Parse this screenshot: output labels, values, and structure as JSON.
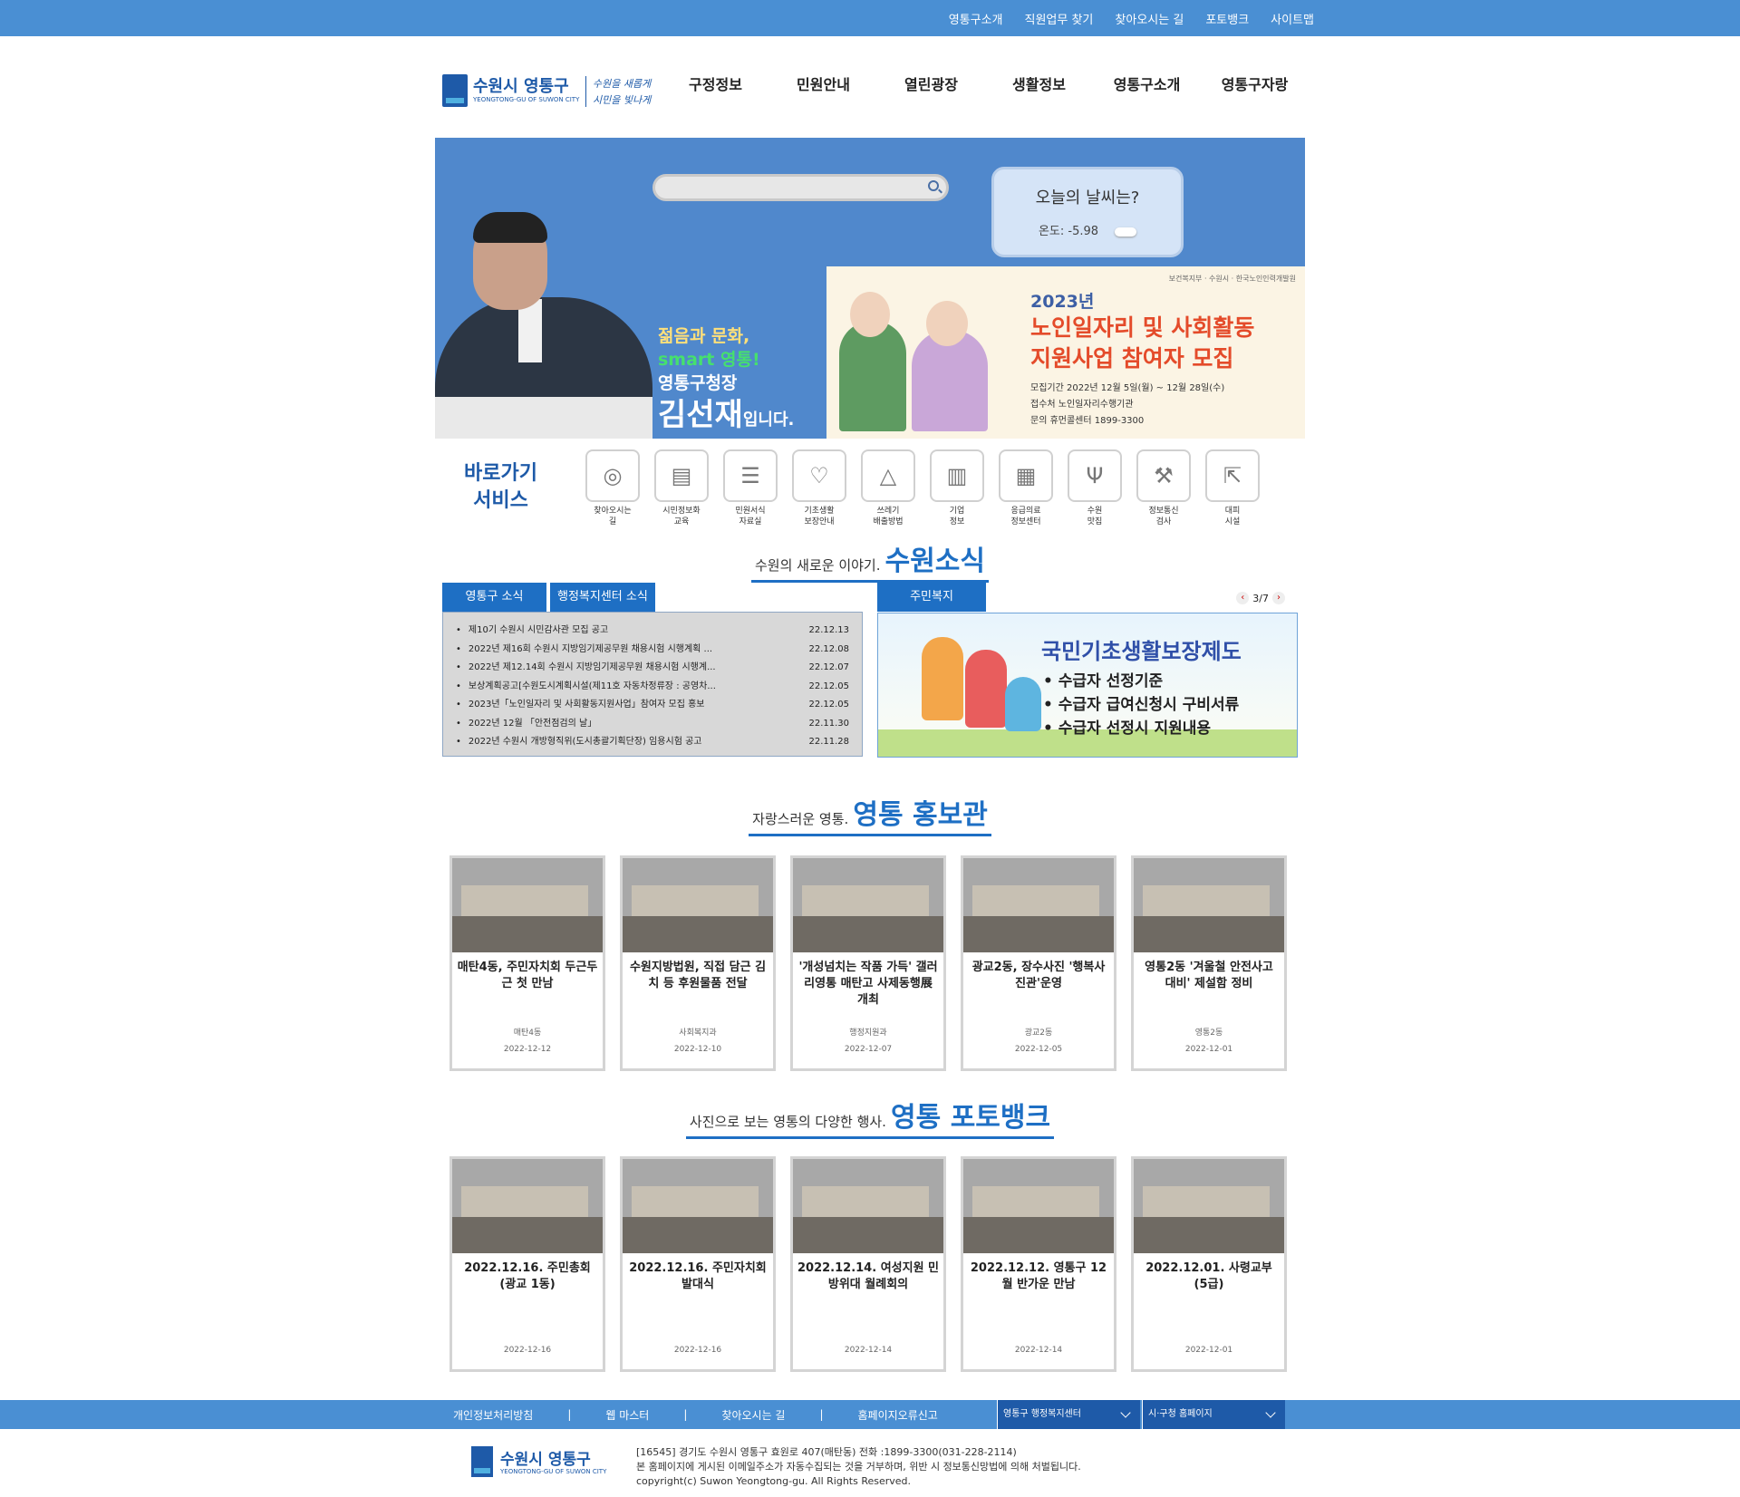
{
  "top_links": [
    "영통구소개",
    "직원업무 찾기",
    "찾아오시는 길",
    "포토뱅크",
    "사이트맵"
  ],
  "logo": {
    "name": "수원시 영통구",
    "eng": "YEONGTONG-GU OF SUWON CITY",
    "slogan1": "수원을 새롭게",
    "slogan2": "시민을 빛나게"
  },
  "nav": [
    "구정정보",
    "민원안내",
    "열린광장",
    "생활정보",
    "영통구소개",
    "영통구자랑"
  ],
  "weather": {
    "title": "오늘의 날씨는?",
    "temp": "온도: -5.98"
  },
  "hero": {
    "line1": "젊음과 문화,",
    "line2": "smart 영통!",
    "line3": "영통구청장",
    "name": "김선재",
    "suffix": "입니다."
  },
  "banner": {
    "logos": "보건복지부 · 수원시 · 한국노인인력개발원",
    "year": "2023년",
    "title1": "노인일자리 및 사회활동",
    "title2": "지원사업 참여자 모집",
    "info1": "모집기간  2022년 12월 5일(월) ~ 12월 28일(수)",
    "info2": "접수처  노인일자리수행기관",
    "info3": "문의  휴먼콜센터 1899-3300"
  },
  "quick": {
    "title1": "바로가기",
    "title2": "서비스",
    "items": [
      {
        "icon": "compass-icon",
        "glyph": "◎",
        "l1": "찾아오시는",
        "l2": "길"
      },
      {
        "icon": "book-icon",
        "glyph": "▤",
        "l1": "시민정보화",
        "l2": "교육"
      },
      {
        "icon": "clipboard-icon",
        "glyph": "☰",
        "l1": "민원서식",
        "l2": "자료실"
      },
      {
        "icon": "heart-icon",
        "glyph": "♡",
        "l1": "기초생활",
        "l2": "보장안내"
      },
      {
        "icon": "trash-bag-icon",
        "glyph": "△",
        "l1": "쓰레기",
        "l2": "배출방법"
      },
      {
        "icon": "building-icon",
        "glyph": "▥",
        "l1": "기업",
        "l2": "정보"
      },
      {
        "icon": "hospital-icon",
        "glyph": "▦",
        "l1": "응급의료",
        "l2": "정보센터"
      },
      {
        "icon": "fork-knife-icon",
        "glyph": "Ψ",
        "l1": "수원",
        "l2": "맛집"
      },
      {
        "icon": "hammer-icon",
        "glyph": "⚒",
        "l1": "정보통신",
        "l2": "검사"
      },
      {
        "icon": "running-exit-icon",
        "glyph": "⇱",
        "l1": "대피",
        "l2": "시설"
      }
    ]
  },
  "news_section": {
    "small": "수원의 새로운 이야기.",
    "big": "수원소식"
  },
  "news": {
    "tabs": [
      "영통구 소식",
      "행정복지센터 소식"
    ],
    "items": [
      {
        "title": "제10기 수원시 시민감사관 모집 공고",
        "date": "22.12.13"
      },
      {
        "title": "2022년 제16회 수원시 지방임기제공무원 채용시험 시행계획 ...",
        "date": "22.12.08"
      },
      {
        "title": "2022년 제12.14회 수원시 지방임기제공무원 채용시험 시행계...",
        "date": "22.12.07"
      },
      {
        "title": "보상계획공고[수원도시계획시설(제11호 자동차정류장 : 공영차...",
        "date": "22.12.05"
      },
      {
        "title": "2023년「노인일자리 및 사회활동지원사업」참여자 모집 홍보",
        "date": "22.12.05"
      },
      {
        "title": "2022년 12월 「안전점검의 날」",
        "date": "22.11.30"
      },
      {
        "title": "2022년 수원시 개방형직위(도시총괄기획단장) 임용시험 공고",
        "date": "22.11.28"
      }
    ]
  },
  "welfare": {
    "tab": "주민복지",
    "page": "3/7",
    "heading": "국민기초생활보장제도",
    "items": [
      "• 수급자 선정기준",
      "• 수급자 급여신청시 구비서류",
      "• 수급자 선정시 지원내용"
    ]
  },
  "promo_section": {
    "small": "자랑스러운 영통.",
    "big": "영통 홍보관"
  },
  "promo": [
    {
      "title": "매탄4동, 주민자치회 두근두근 첫 만남",
      "dept": "매탄4동",
      "date": "2022-12-12"
    },
    {
      "title": "수원지방법원, 직접 담근 김치 등 후원물품 전달",
      "dept": "사회복지과",
      "date": "2022-12-10"
    },
    {
      "title": "'개성넘치는 작품 가득' 갤러리영통 매탄고 사제동행展 개최",
      "dept": "행정지원과",
      "date": "2022-12-07"
    },
    {
      "title": "광교2동, 장수사진 '행복사진관'운영",
      "dept": "광교2동",
      "date": "2022-12-05"
    },
    {
      "title": "영통2동 '겨울철 안전사고 대비' 제설함 정비",
      "dept": "영통2동",
      "date": "2022-12-01"
    }
  ],
  "photo_section": {
    "small": "사진으로 보는 영통의 다양한 행사.",
    "big": "영통 포토뱅크"
  },
  "photos": [
    {
      "title": "2022.12.16. 주민총회 (광교 1동)",
      "date": "2022-12-16"
    },
    {
      "title": "2022.12.16. 주민자치회 발대식",
      "date": "2022-12-16"
    },
    {
      "title": "2022.12.14. 여성지원 민방위대 월례회의",
      "date": "2022-12-14"
    },
    {
      "title": "2022.12.12. 영통구 12월 반가운 만남",
      "date": "2022-12-14"
    },
    {
      "title": "2022.12.01. 사령교부 (5급)",
      "date": "2022-12-01"
    }
  ],
  "footer": {
    "links": [
      "개인정보처리방침",
      "웹 마스터",
      "찾아오시는 길",
      "홈페이지오류신고"
    ],
    "sep": "|",
    "select1": "영통구 행정복지센터",
    "select2": "시·구청 홈페이지",
    "address": "[16545] 경기도 수원시 영통구 효원로 407(매탄동) 전화 :1899-3300(031-228-2114)",
    "notice": "본 홈페이지에 게시된 이메일주소가 자동수집되는 것을 거부하며, 위반 시 정보통신망법에 의해 처벌됩니다.",
    "copyright": "copyright(c) Suwon Yeongtong-gu. All Rights Reserved."
  }
}
